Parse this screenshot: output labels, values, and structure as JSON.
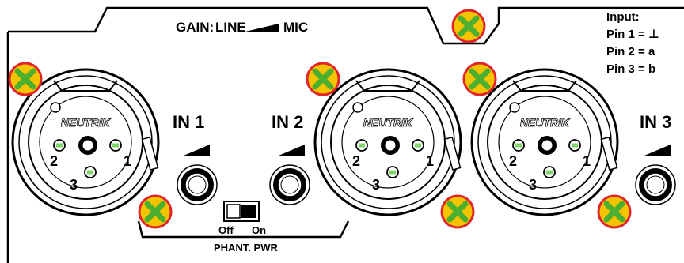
{
  "panel": {
    "gain": {
      "prefix": "GAIN:",
      "line": "LINE",
      "mic": "MIC"
    },
    "input_info": {
      "title": "Input:",
      "pin1": "Pin 1 = ⊥",
      "pin2": "Pin 2 =  a",
      "pin3": "Pin 3 =  b"
    },
    "inputs": [
      {
        "label": "IN 1",
        "brand": "NEUTRIK",
        "pin_left": "2",
        "pin_right": "1",
        "pin_bottom": "3"
      },
      {
        "label": "IN 2",
        "brand": "NEUTRIK",
        "pin_left": "2",
        "pin_right": "1",
        "pin_bottom": "3"
      },
      {
        "label": "IN 3",
        "brand": "NEUTRIK",
        "pin_left": "2",
        "pin_right": "1",
        "pin_bottom": "3"
      }
    ],
    "phantom": {
      "off": "Off",
      "on": "On",
      "label": "PHANT. PWR",
      "state": "off"
    },
    "colors": {
      "screw_fill": "#f5c400",
      "screw_ring": "#e0242a",
      "screw_cross": "#4caf2f",
      "pin_green": "#7fd46a",
      "line": "#000000",
      "bg": "#ffffff"
    }
  }
}
